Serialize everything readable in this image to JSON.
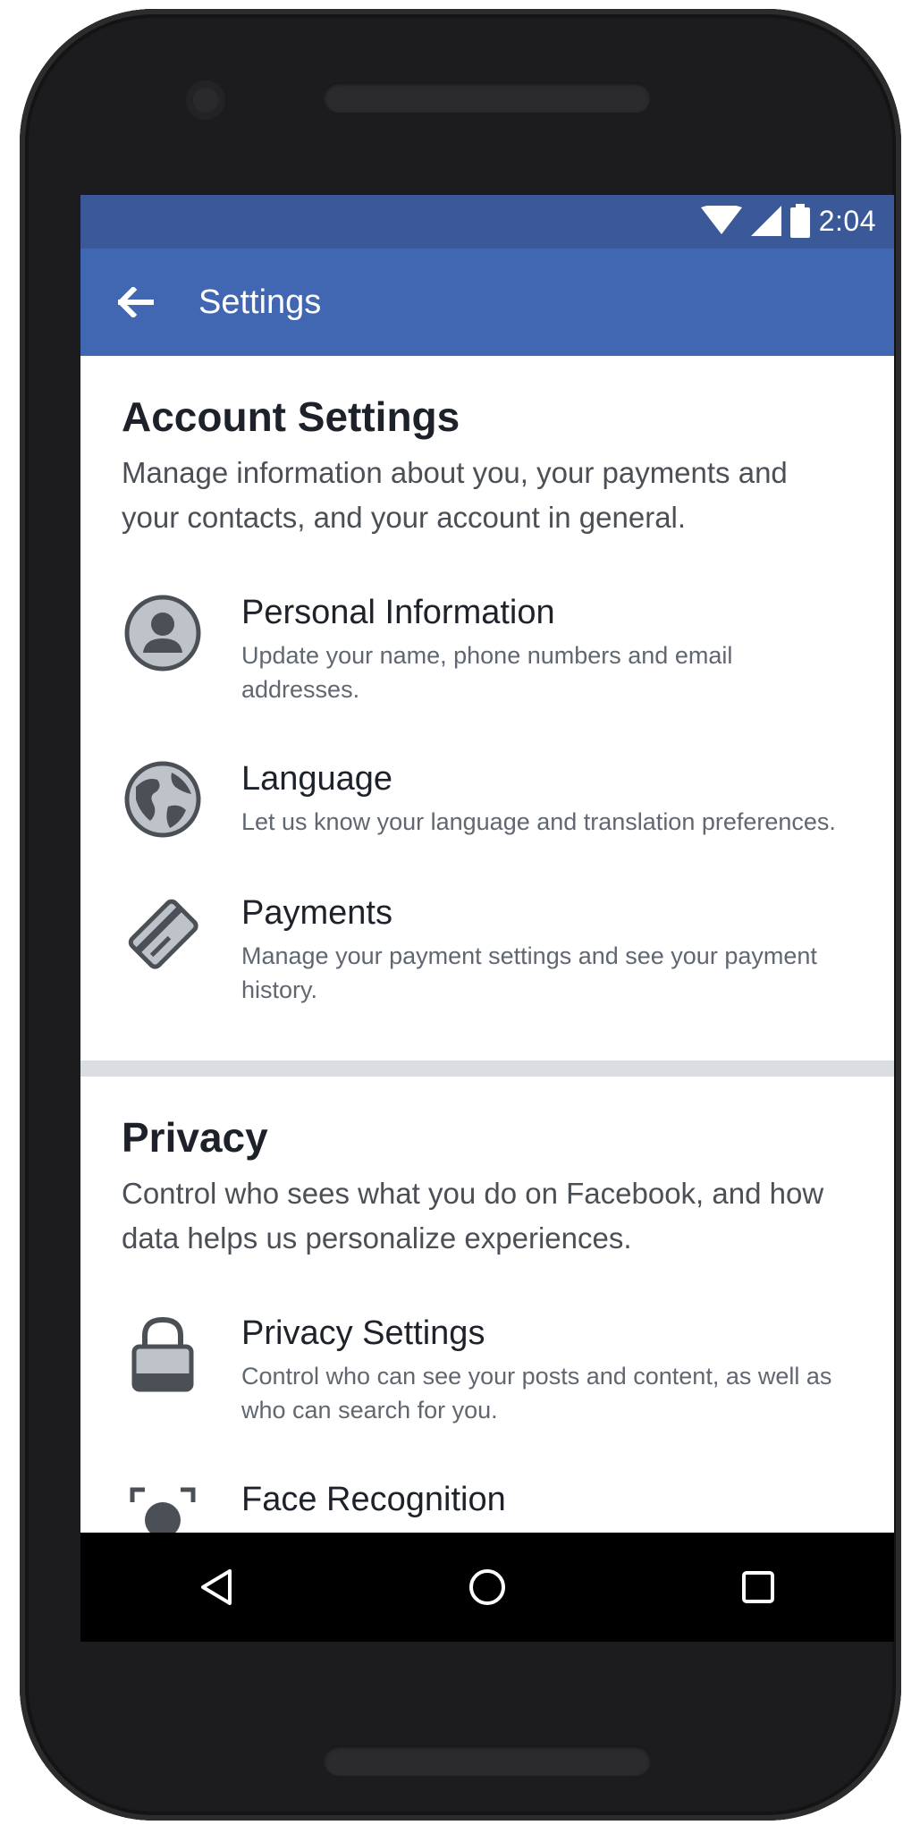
{
  "status_bar": {
    "time": "2:04",
    "icons": [
      "wifi-icon",
      "cellular-signal-icon",
      "battery-icon"
    ]
  },
  "app_bar": {
    "title": "Settings",
    "back_icon": "arrow-left-icon"
  },
  "account_section": {
    "title": "Account Settings",
    "description": "Manage information about you, your payments and your contacts, and your account in general.",
    "items": [
      {
        "title": "Personal Information",
        "description": "Update your name, phone numbers and email addresses.",
        "icon": "person-icon"
      },
      {
        "title": "Language",
        "description": "Let us know your language and translation preferences.",
        "icon": "globe-icon"
      },
      {
        "title": "Payments",
        "description": "Manage your payment settings and see your payment history.",
        "icon": "credit-card-icon"
      }
    ]
  },
  "privacy_section": {
    "title": "Privacy",
    "description": "Control who sees what you do on Facebook, and how data helps us personalize experiences.",
    "items": [
      {
        "title": "Privacy Settings",
        "description": "Control who can see your posts and content, as well as who can search for you.",
        "icon": "lock-icon"
      },
      {
        "title": "Face Recognition",
        "description": "",
        "icon": "face-recognition-icon"
      }
    ]
  },
  "nav_bar": {
    "buttons": [
      "back-triangle-icon",
      "home-circle-icon",
      "recents-square-icon"
    ]
  },
  "colors": {
    "status_bar": "#3b5998",
    "app_bar": "#4267b2",
    "divider": "#dadde1",
    "icon_fill": "#bec3c9",
    "icon_stroke": "#4b4f56"
  }
}
